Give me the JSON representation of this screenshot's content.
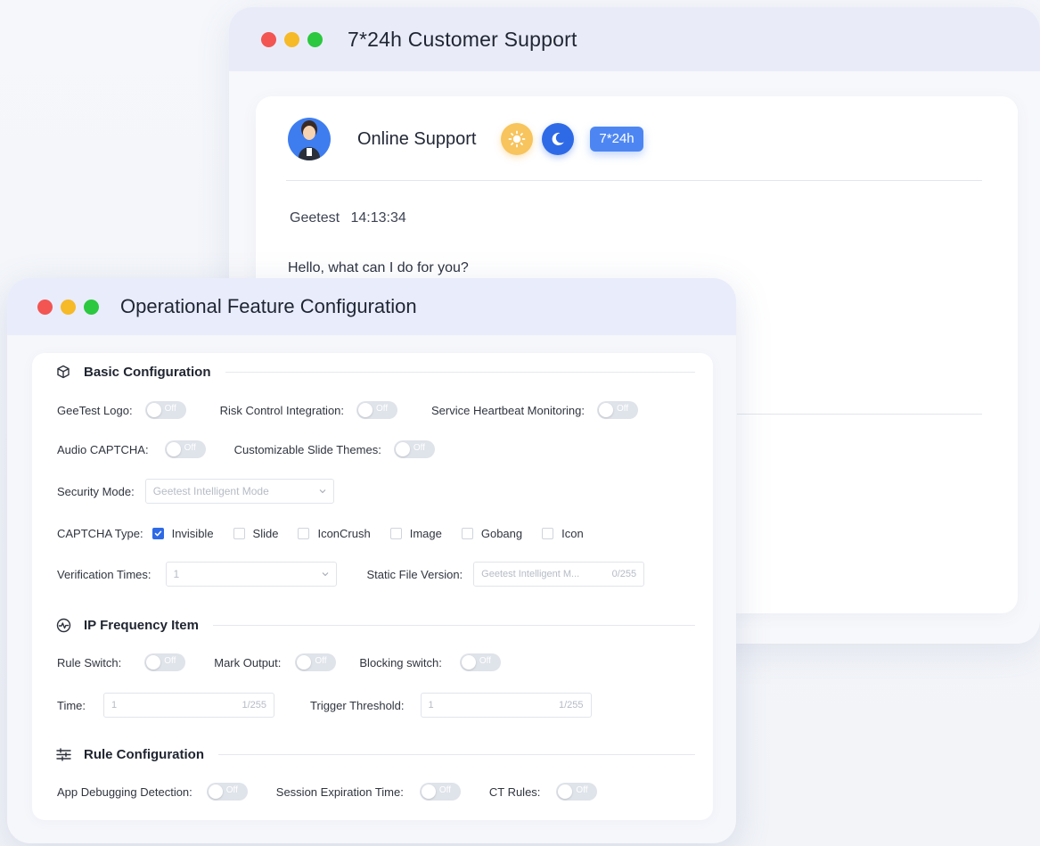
{
  "back_window": {
    "title": "7*24h Customer Support",
    "agent_name": "Online Support",
    "badge": "7*24h",
    "message": {
      "sender": "Geetest",
      "time": "14:13:34",
      "text": "Hello, what can I do for you?"
    }
  },
  "front_window": {
    "title": "Operational Feature Configuration",
    "basic": {
      "heading": "Basic Configuration",
      "geetest_logo_label": "GeeTest Logo:",
      "risk_control_label": "Risk Control Integration:",
      "heartbeat_label": "Service Heartbeat Monitoring:",
      "audio_captcha_label": "Audio CAPTCHA:",
      "slide_themes_label": "Customizable Slide Themes:",
      "security_mode_label": "Security Mode:",
      "security_mode_value": "Geetest Intelligent Mode",
      "captcha_type_label": "CAPTCHA Type:",
      "captcha_types": [
        {
          "label": "Invisible",
          "checked": true
        },
        {
          "label": "Slide",
          "checked": false
        },
        {
          "label": "IconCrush",
          "checked": false
        },
        {
          "label": "Image",
          "checked": false
        },
        {
          "label": "Gobang",
          "checked": false
        },
        {
          "label": "Icon",
          "checked": false
        }
      ],
      "verification_times_label": "Verification Times:",
      "verification_times_value": "1",
      "static_file_label": "Static File Version:",
      "static_file_placeholder": "Geetest Intelligent M...",
      "static_file_count": "0/255"
    },
    "ip": {
      "heading": "IP Frequency Item",
      "rule_switch_label": "Rule Switch:",
      "mark_output_label": "Mark Output:",
      "blocking_switch_label": "Blocking switch:",
      "time_label": "Time:",
      "time_value": "1",
      "time_count": "1/255",
      "trigger_label": "Trigger Threshold:",
      "trigger_value": "1",
      "trigger_count": "1/255"
    },
    "rule": {
      "heading": "Rule Configuration",
      "app_debug_label": "App Debugging Detection:",
      "session_exp_label": "Session Expiration Time:",
      "ct_rules_label": "CT Rules:"
    },
    "toggle_off_text": "Off"
  },
  "colors": {
    "accent": "#2f6ae6",
    "badge": "#4d86f3",
    "sun": "#f7c45d",
    "dot_red": "#f25552",
    "dot_yellow": "#f6b928",
    "dot_green": "#2bc840"
  }
}
